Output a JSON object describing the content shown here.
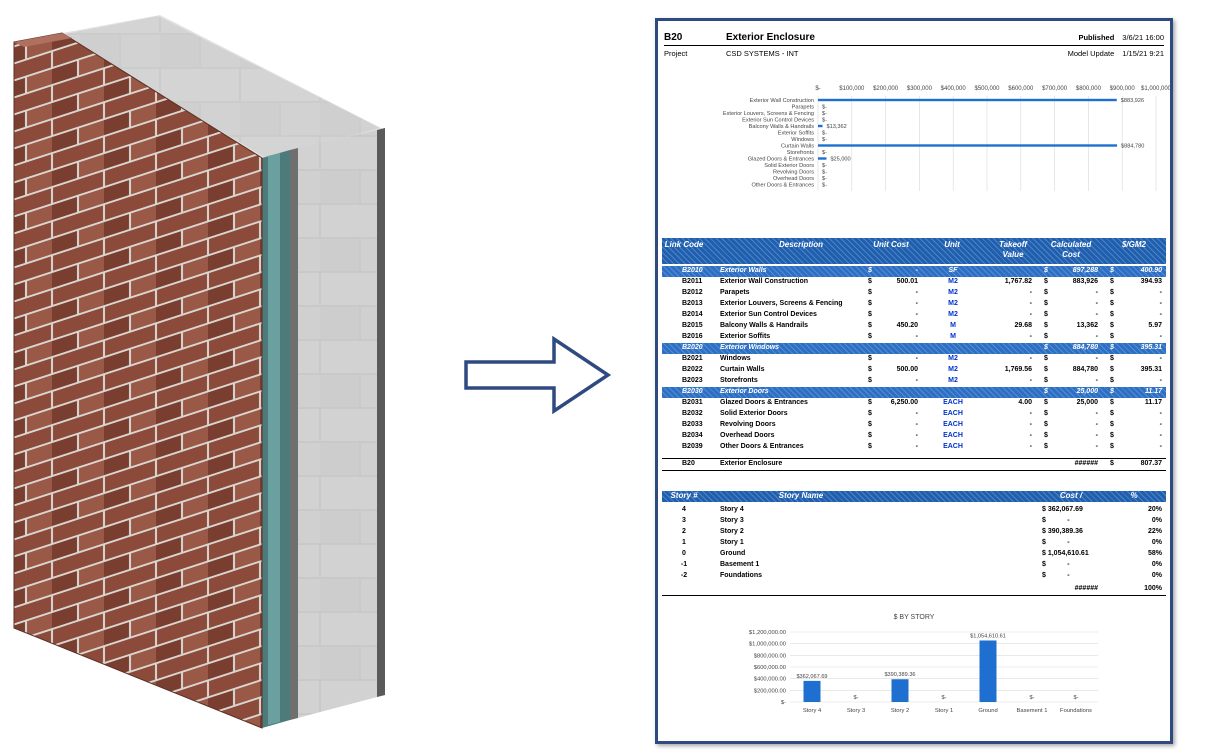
{
  "report": {
    "code": "B20",
    "title": "Exterior Enclosure",
    "published_label": "Published",
    "published_value": "3/6/21 16:00",
    "project_label": "Project",
    "project_value": "CSD SYSTEMS - INT",
    "model_update_label": "Model Update",
    "model_update_value": "1/15/21 9:21"
  },
  "colors": {
    "accent": "#1f5fb0",
    "bar": "#1f6fd0",
    "frame": "#2e4a80",
    "arrow": "#2e4a80"
  },
  "chart_data": [
    {
      "type": "bar",
      "orientation": "horizontal",
      "x_ticks": [
        "$-",
        "$100,000",
        "$200,000",
        "$300,000",
        "$400,000",
        "$500,000",
        "$600,000",
        "$700,000",
        "$800,000",
        "$900,000",
        "$1,000,000"
      ],
      "xlim": [
        0,
        1000000
      ],
      "categories": [
        "Exterior Wall Construction",
        "Parapets",
        "Exterior Louvers, Screens & Fencing",
        "Exterior Sun Control Devices",
        "Balcony Walls & Handrails",
        "Exterior Soffits",
        "Windows",
        "Curtain Walls",
        "Storefronts",
        "Glazed Doors & Entrances",
        "Solid Exterior Doors",
        "Revolving Doors",
        "Overhead Doors",
        "Other Doors & Entrances"
      ],
      "values": [
        883926,
        0,
        0,
        0,
        13362,
        0,
        0,
        884780,
        0,
        25000,
        0,
        0,
        0,
        0
      ],
      "data_labels": [
        "$883,926",
        "$-",
        "$-",
        "$-",
        "$13,362",
        "$-",
        "$-",
        "$884,780",
        "$-",
        "$25,000",
        "$-",
        "$-",
        "$-",
        "$-"
      ],
      "grid": true
    },
    {
      "type": "bar",
      "title": "$ BY STORY",
      "categories": [
        "Story 4",
        "Story 3",
        "Story 2",
        "Story 1",
        "Ground",
        "Basement 1",
        "Foundations"
      ],
      "values": [
        362067.69,
        0,
        390389.36,
        0,
        1054610.61,
        0,
        0
      ],
      "data_labels": [
        "$362,067.69",
        "$-",
        "$390,389.36",
        "$-",
        "$1,054,610.61",
        "$-",
        "$-"
      ],
      "y_ticks": [
        "$-",
        "$200,000.00",
        "$400,000.00",
        "$600,000.00",
        "$800,000.00",
        "$1,000,000.00",
        "$1,200,000.00"
      ],
      "ylim": [
        0,
        1200000
      ],
      "grid": true
    }
  ],
  "table1": {
    "headers": {
      "code": "Link Code",
      "desc": "Description",
      "unit_cost": "Unit Cost",
      "unit": "Unit",
      "takeoff": "Takeoff",
      "takeoff2": "Value",
      "calc": "Calculated",
      "calc2": "Cost",
      "gm2": "$/GM2"
    },
    "rows": [
      {
        "group": true,
        "code": "B2010",
        "desc": "Exterior Walls",
        "cur1": "$",
        "unit_cost": "-",
        "unit": "SF",
        "takeoff": "",
        "cur2": "$",
        "calc": "897,288",
        "cur3": "$",
        "gm2": "400.90"
      },
      {
        "group": false,
        "code": "B2011",
        "desc": "Exterior Wall Construction",
        "cur1": "$",
        "unit_cost": "500.01",
        "unit": "M2",
        "takeoff": "1,767.82",
        "cur2": "$",
        "calc": "883,926",
        "cur3": "$",
        "gm2": "394.93"
      },
      {
        "group": false,
        "code": "B2012",
        "desc": "Parapets",
        "cur1": "$",
        "unit_cost": "-",
        "unit": "M2",
        "takeoff": "-",
        "cur2": "$",
        "calc": "-",
        "cur3": "$",
        "gm2": "-"
      },
      {
        "group": false,
        "code": "B2013",
        "desc": "Exterior Louvers, Screens & Fencing",
        "cur1": "$",
        "unit_cost": "-",
        "unit": "M2",
        "takeoff": "-",
        "cur2": "$",
        "calc": "-",
        "cur3": "$",
        "gm2": "-"
      },
      {
        "group": false,
        "code": "B2014",
        "desc": "Exterior Sun Control Devices",
        "cur1": "$",
        "unit_cost": "-",
        "unit": "M2",
        "takeoff": "-",
        "cur2": "$",
        "calc": "-",
        "cur3": "$",
        "gm2": "-"
      },
      {
        "group": false,
        "code": "B2015",
        "desc": "Balcony Walls & Handrails",
        "cur1": "$",
        "unit_cost": "450.20",
        "unit": "M",
        "takeoff": "29.68",
        "cur2": "$",
        "calc": "13,362",
        "cur3": "$",
        "gm2": "5.97"
      },
      {
        "group": false,
        "code": "B2016",
        "desc": "Exterior Soffits",
        "cur1": "$",
        "unit_cost": "-",
        "unit": "M",
        "takeoff": "-",
        "cur2": "$",
        "calc": "-",
        "cur3": "$",
        "gm2": "-"
      },
      {
        "group": true,
        "code": "B2020",
        "desc": "Exterior Windows",
        "cur1": "",
        "unit_cost": "",
        "unit": "",
        "takeoff": "",
        "cur2": "$",
        "calc": "884,780",
        "cur3": "$",
        "gm2": "395.31"
      },
      {
        "group": false,
        "code": "B2021",
        "desc": "Windows",
        "cur1": "$",
        "unit_cost": "-",
        "unit": "M2",
        "takeoff": "-",
        "cur2": "$",
        "calc": "-",
        "cur3": "$",
        "gm2": "-"
      },
      {
        "group": false,
        "code": "B2022",
        "desc": "Curtain Walls",
        "cur1": "$",
        "unit_cost": "500.00",
        "unit": "M2",
        "takeoff": "1,769.56",
        "cur2": "$",
        "calc": "884,780",
        "cur3": "$",
        "gm2": "395.31"
      },
      {
        "group": false,
        "code": "B2023",
        "desc": "Storefronts",
        "cur1": "$",
        "unit_cost": "-",
        "unit": "M2",
        "takeoff": "-",
        "cur2": "$",
        "calc": "-",
        "cur3": "$",
        "gm2": "-"
      },
      {
        "group": true,
        "code": "B2030",
        "desc": "Exterior Doors",
        "cur1": "",
        "unit_cost": "",
        "unit": "",
        "takeoff": "",
        "cur2": "$",
        "calc": "25,000",
        "cur3": "$",
        "gm2": "11.17"
      },
      {
        "group": false,
        "code": "B2031",
        "desc": "Glazed Doors & Entrances",
        "cur1": "$",
        "unit_cost": "6,250.00",
        "unit": "EACH",
        "takeoff": "4.00",
        "cur2": "$",
        "calc": "25,000",
        "cur3": "$",
        "gm2": "11.17"
      },
      {
        "group": false,
        "code": "B2032",
        "desc": "Solid Exterior Doors",
        "cur1": "$",
        "unit_cost": "-",
        "unit": "EACH",
        "takeoff": "-",
        "cur2": "$",
        "calc": "-",
        "cur3": "$",
        "gm2": "-"
      },
      {
        "group": false,
        "code": "B2033",
        "desc": "Revolving Doors",
        "cur1": "$",
        "unit_cost": "-",
        "unit": "EACH",
        "takeoff": "-",
        "cur2": "$",
        "calc": "-",
        "cur3": "$",
        "gm2": "-"
      },
      {
        "group": false,
        "code": "B2034",
        "desc": "Overhead Doors",
        "cur1": "$",
        "unit_cost": "-",
        "unit": "EACH",
        "takeoff": "-",
        "cur2": "$",
        "calc": "-",
        "cur3": "$",
        "gm2": "-"
      },
      {
        "group": false,
        "code": "B2039",
        "desc": "Other Doors & Entrances",
        "cur1": "$",
        "unit_cost": "-",
        "unit": "EACH",
        "takeoff": "-",
        "cur2": "$",
        "calc": "-",
        "cur3": "$",
        "gm2": "-"
      }
    ],
    "total": {
      "code": "B20",
      "desc": "Exterior Enclosure",
      "calc": "######",
      "cur": "$",
      "gm2": "807.37"
    }
  },
  "table2": {
    "headers": {
      "num": "Story #",
      "name": "Story Name",
      "cost": "Cost /",
      "pct": "%"
    },
    "rows": [
      {
        "num": "4",
        "name": "Story 4",
        "cost": "$ 362,067.69",
        "pct": "20%"
      },
      {
        "num": "3",
        "name": "Story 3",
        "cost": "$           -",
        "pct": "0%"
      },
      {
        "num": "2",
        "name": "Story 2",
        "cost": "$ 390,389.36",
        "pct": "22%"
      },
      {
        "num": "1",
        "name": "Story 1",
        "cost": "$           -",
        "pct": "0%"
      },
      {
        "num": "0",
        "name": "Ground",
        "cost": "$ 1,054,610.61",
        "pct": "58%"
      },
      {
        "num": "-1",
        "name": "Basement 1",
        "cost": "$           -",
        "pct": "0%"
      },
      {
        "num": "-2",
        "name": "Foundations",
        "cost": "$           -",
        "pct": "0%"
      }
    ],
    "total": {
      "cost": "######",
      "pct": "100%"
    }
  }
}
